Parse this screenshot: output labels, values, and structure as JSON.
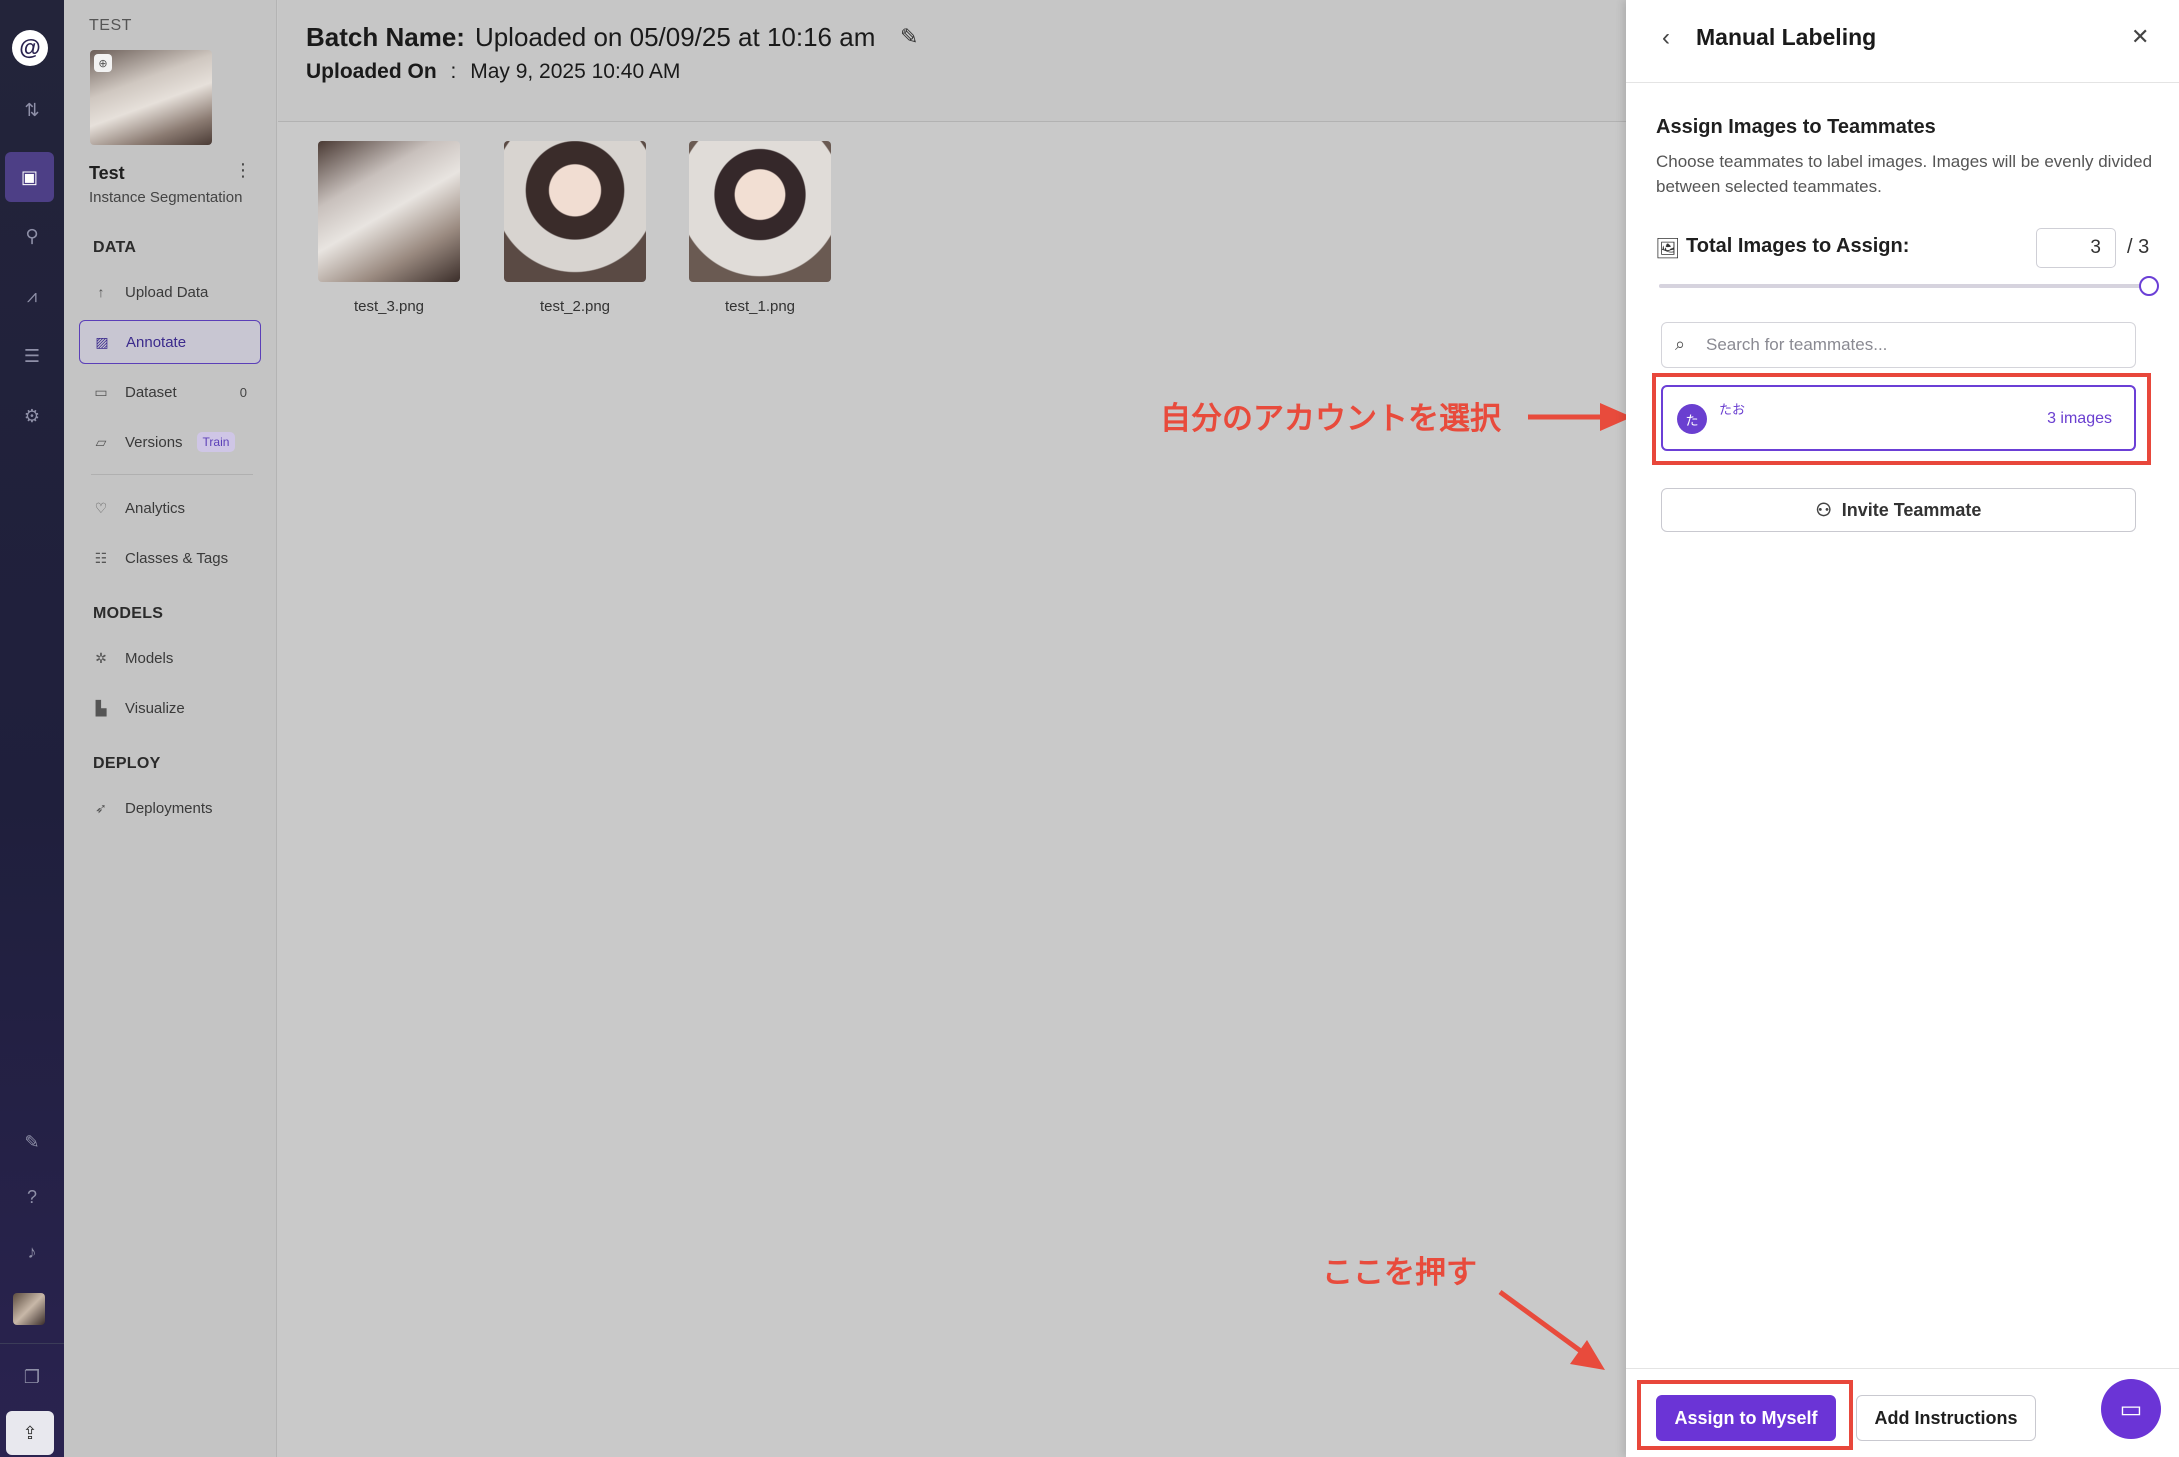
{
  "rail": {
    "logo": "@",
    "icons": [
      "transfer-icon",
      "inbox-icon",
      "workflow-icon",
      "chart-icon",
      "database-icon",
      "settings-icon"
    ],
    "bottom_icons": [
      "rocket-icon",
      "help-icon",
      "bell-icon"
    ]
  },
  "sidebar": {
    "workspace": "TEST",
    "project_name": "Test",
    "project_type": "Instance Segmentation",
    "sections": {
      "data": "DATA",
      "models": "MODELS",
      "deploy": "DEPLOY"
    },
    "items": {
      "upload": "Upload Data",
      "annotate": "Annotate",
      "dataset": "Dataset",
      "dataset_count": "0",
      "versions": "Versions",
      "versions_badge": "Train",
      "analytics": "Analytics",
      "classes": "Classes & Tags",
      "models": "Models",
      "visualize": "Visualize",
      "deployments": "Deployments"
    }
  },
  "main": {
    "batch_label": "Batch Name:",
    "batch_name": "Uploaded on 05/09/25 at 10:16 am",
    "uploaded_label": "Uploaded On",
    "uploaded_sep": ":",
    "uploaded_value": "May 9, 2025 10:40 AM",
    "images": [
      {
        "file": "test_3.png"
      },
      {
        "file": "test_2.png"
      },
      {
        "file": "test_1.png"
      }
    ]
  },
  "annotations": {
    "select_account": "自分のアカウントを選択",
    "press_here": "ここを押す",
    "color": "#e84b3c"
  },
  "panel": {
    "title": "Manual Labeling",
    "assign_heading": "Assign Images to Teammates",
    "assign_desc": "Choose teammates to label images. Images will be evenly divided between selected teammates.",
    "total_label": "Total Images to Assign:",
    "total_value": "3",
    "total_max": "/ 3",
    "slider_fraction": 1.0,
    "search_placeholder": "Search for teammates...",
    "teammate": {
      "avatar_letter": "た",
      "name": "たお",
      "images": "3 images"
    },
    "invite_label": "Invite Teammate",
    "assign_myself_label": "Assign to Myself",
    "add_instructions_label": "Add Instructions",
    "accent_color": "#6b34d6"
  }
}
